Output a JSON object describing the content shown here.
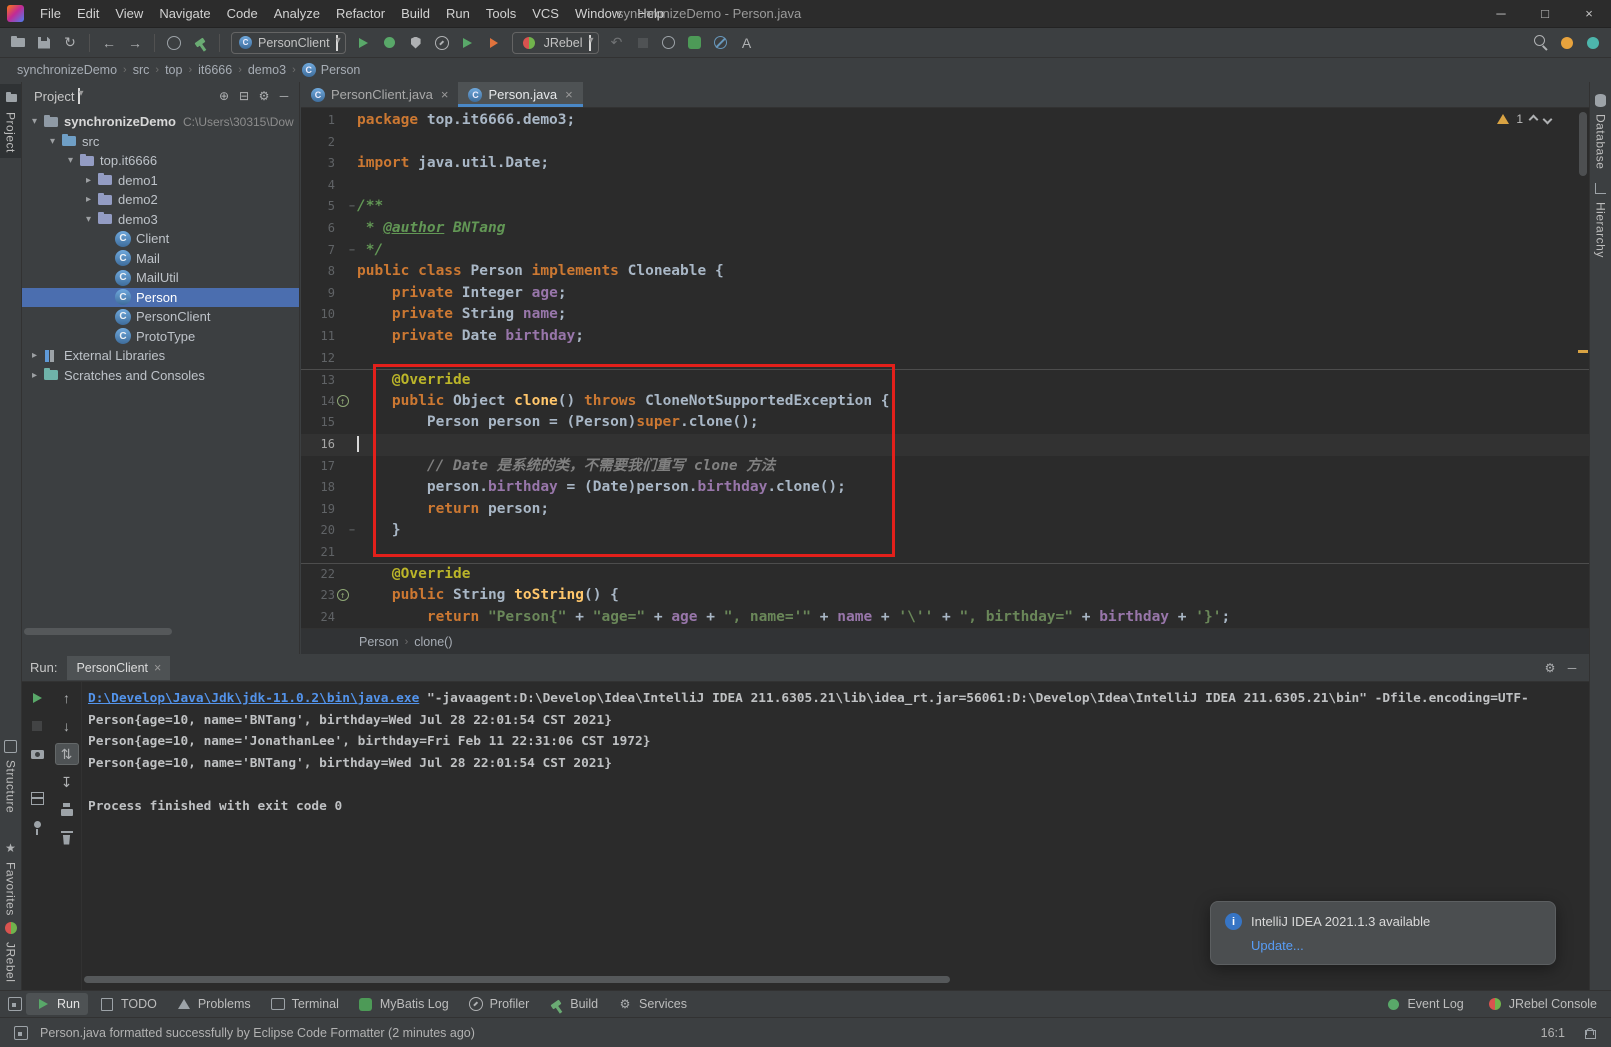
{
  "colors": {
    "accent_blue": "#4a88c7",
    "selection_blue": "#4b6eaf",
    "annotation_red": "#e3201b",
    "run_green": "#59a869",
    "warning_yellow": "#d9a343",
    "console_link": "#5394ec"
  },
  "title_bar": {
    "menus": [
      "File",
      "Edit",
      "View",
      "Navigate",
      "Code",
      "Analyze",
      "Refactor",
      "Build",
      "Run",
      "Tools",
      "VCS",
      "Window",
      "Help"
    ],
    "title": "synchronizeDemo - Person.java",
    "window_controls": [
      "minimize",
      "maximize",
      "close"
    ]
  },
  "toolbar": {
    "left_icons": [
      "open-icon",
      "save-icon",
      "sync-icon",
      "back-icon",
      "forward-icon",
      "run-anything-icon",
      "build-hammer-icon"
    ],
    "run_config": "PersonClient",
    "run_icons": [
      "run-icon",
      "debug-icon",
      "coverage-icon",
      "profiler-icon",
      "rerun-icon",
      "run-with-jrebel-icon"
    ],
    "jrebel_label": "JRebel",
    "mid_icons": [
      "revert-icon",
      "stop-icon",
      "code-with-me-icon",
      "mybatis-icon",
      "zen-mode-icon",
      "translate-icon"
    ],
    "right_icons": [
      "search-icon",
      "update-icon",
      "gradle-refresh-icon"
    ]
  },
  "breadcrumbs": [
    "synchronizeDemo",
    "src",
    "top",
    "it6666",
    "demo3",
    "Person"
  ],
  "project_panel": {
    "header": "Project",
    "header_icons": [
      "locate-icon",
      "collapse-all-icon",
      "settings-icon",
      "hide-icon"
    ],
    "tree": [
      {
        "label": "synchronizeDemo",
        "meta": "C:\\Users\\30315\\Dow",
        "depth": 0,
        "icon": "project-folder",
        "chevron": "down",
        "root": true
      },
      {
        "label": "src",
        "depth": 1,
        "icon": "src-folder",
        "chevron": "down"
      },
      {
        "label": "top.it6666",
        "depth": 2,
        "icon": "package",
        "chevron": "down"
      },
      {
        "label": "demo1",
        "depth": 3,
        "icon": "package",
        "chevron": "right"
      },
      {
        "label": "demo2",
        "depth": 3,
        "icon": "package",
        "chevron": "right"
      },
      {
        "label": "demo3",
        "depth": 3,
        "icon": "package",
        "chevron": "down"
      },
      {
        "label": "Client",
        "depth": 4,
        "icon": "class"
      },
      {
        "label": "Mail",
        "depth": 4,
        "icon": "class"
      },
      {
        "label": "MailUtil",
        "depth": 4,
        "icon": "class"
      },
      {
        "label": "Person",
        "depth": 4,
        "icon": "class",
        "selected": true
      },
      {
        "label": "PersonClient",
        "depth": 4,
        "icon": "class"
      },
      {
        "label": "ProtoType",
        "depth": 4,
        "icon": "class"
      },
      {
        "label": "External Libraries",
        "depth": 0,
        "icon": "libraries",
        "chevron": "right"
      },
      {
        "label": "Scratches and Consoles",
        "depth": 0,
        "icon": "scratches",
        "chevron": "right"
      }
    ]
  },
  "editor": {
    "tabs": [
      {
        "label": "PersonClient.java",
        "icon": "class",
        "active": false
      },
      {
        "label": "Person.java",
        "icon": "class",
        "active": true
      }
    ],
    "inspection_warnings": "1",
    "breadcrumb": [
      "Person",
      "clone()"
    ],
    "code": [
      {
        "n": 1,
        "t": [
          [
            "kw",
            "package"
          ],
          [
            "pl",
            " top.it6666.demo3;"
          ]
        ]
      },
      {
        "n": 2,
        "t": []
      },
      {
        "n": 3,
        "t": [
          [
            "kw",
            "import"
          ],
          [
            "pl",
            " java.util.Date;"
          ]
        ]
      },
      {
        "n": 4,
        "t": []
      },
      {
        "n": 5,
        "t": [
          [
            "doc",
            "/**"
          ]
        ],
        "g": "fold"
      },
      {
        "n": 6,
        "t": [
          [
            "doc",
            " * "
          ],
          [
            "doctag",
            "@author"
          ],
          [
            "docit",
            " BNTang"
          ]
        ]
      },
      {
        "n": 7,
        "t": [
          [
            "doc",
            " */"
          ]
        ],
        "g": "fold"
      },
      {
        "n": 8,
        "t": [
          [
            "kw",
            "public class "
          ],
          [
            "pl",
            "Person "
          ],
          [
            "kw",
            "implements "
          ],
          [
            "pl",
            "Cloneable {"
          ]
        ]
      },
      {
        "n": 9,
        "t": [
          [
            "pl",
            "    "
          ],
          [
            "kw",
            "private "
          ],
          [
            "pl",
            "Integer "
          ],
          [
            "fld",
            "age"
          ],
          [
            "pl",
            ";"
          ]
        ]
      },
      {
        "n": 10,
        "t": [
          [
            "pl",
            "    "
          ],
          [
            "kw",
            "private "
          ],
          [
            "pl",
            "String "
          ],
          [
            "fld",
            "name"
          ],
          [
            "pl",
            ";"
          ]
        ]
      },
      {
        "n": 11,
        "t": [
          [
            "pl",
            "    "
          ],
          [
            "kw",
            "private "
          ],
          [
            "pl",
            "Date "
          ],
          [
            "fld",
            "birthday"
          ],
          [
            "pl",
            ";"
          ]
        ]
      },
      {
        "n": 12,
        "t": []
      },
      {
        "n": 13,
        "t": [
          [
            "pl",
            "    "
          ],
          [
            "anno",
            "@Override"
          ]
        ],
        "sep": true
      },
      {
        "n": 14,
        "t": [
          [
            "pl",
            "    "
          ],
          [
            "kw",
            "public "
          ],
          [
            "pl",
            "Object "
          ],
          [
            "mth",
            "clone"
          ],
          [
            "pl",
            "() "
          ],
          [
            "kw",
            "throws "
          ],
          [
            "pl",
            "CloneNotSupportedException {"
          ]
        ],
        "g": "override"
      },
      {
        "n": 15,
        "t": [
          [
            "pl",
            "        Person person = (Person)"
          ],
          [
            "kw",
            "super"
          ],
          [
            "pl",
            ".clone();"
          ]
        ]
      },
      {
        "n": 16,
        "t": [],
        "cur": true
      },
      {
        "n": 17,
        "t": [
          [
            "pl",
            "        "
          ],
          [
            "cmt",
            "// Date 是系统的类，不需要我们重写 clone 方法"
          ]
        ]
      },
      {
        "n": 18,
        "t": [
          [
            "pl",
            "        person."
          ],
          [
            "fld",
            "birthday"
          ],
          [
            "pl",
            " = (Date)person."
          ],
          [
            "fld",
            "birthday"
          ],
          [
            "pl",
            ".clone();"
          ]
        ]
      },
      {
        "n": 19,
        "t": [
          [
            "pl",
            "        "
          ],
          [
            "kw",
            "return"
          ],
          [
            "pl",
            " person;"
          ]
        ]
      },
      {
        "n": 20,
        "t": [
          [
            "pl",
            "    }"
          ]
        ],
        "g": "fold"
      },
      {
        "n": 21,
        "t": []
      },
      {
        "n": 22,
        "t": [
          [
            "pl",
            "    "
          ],
          [
            "anno",
            "@Override"
          ]
        ],
        "sep": true
      },
      {
        "n": 23,
        "t": [
          [
            "pl",
            "    "
          ],
          [
            "kw",
            "public "
          ],
          [
            "pl",
            "String "
          ],
          [
            "mth",
            "toString"
          ],
          [
            "pl",
            "() {"
          ]
        ],
        "g": "override"
      },
      {
        "n": 24,
        "t": [
          [
            "pl",
            "        "
          ],
          [
            "kw",
            "return "
          ],
          [
            "str",
            "\"Person{\""
          ],
          [
            "pl",
            " + "
          ],
          [
            "str",
            "\"age=\""
          ],
          [
            "pl",
            " + "
          ],
          [
            "fld",
            "age"
          ],
          [
            "pl",
            " + "
          ],
          [
            "str",
            "\", name='\""
          ],
          [
            "pl",
            " + "
          ],
          [
            "fld",
            "name"
          ],
          [
            "pl",
            " + "
          ],
          [
            "str",
            "'\\''"
          ],
          [
            "pl",
            " + "
          ],
          [
            "str",
            "\", birthday=\""
          ],
          [
            "pl",
            " + "
          ],
          [
            "fld",
            "birthday"
          ],
          [
            "pl",
            " + "
          ],
          [
            "str",
            "'}'"
          ],
          [
            "pl",
            ";"
          ]
        ]
      }
    ]
  },
  "run_panel": {
    "label": "Run:",
    "tab": "PersonClient",
    "header_icons": [
      "settings-icon",
      "hide-icon"
    ],
    "toolbar_main": [
      "rerun-icon",
      "stop-icon",
      "profiler-snapshot-icon",
      "restore-layout-icon",
      "pin-icon"
    ],
    "toolbar_console": [
      "prev-occurrence-icon",
      "next-occurrence-icon",
      "soft-wrap-icon",
      "scroll-to-end-icon",
      "print-icon",
      "clear-all-icon"
    ],
    "console": [
      {
        "s": [
          [
            "link",
            "D:\\Develop\\Java\\Jdk\\jdk-11.0.2\\bin\\java.exe"
          ],
          [
            "pl",
            " \"-javaagent:D:\\Develop\\Idea\\IntelliJ IDEA 211.6305.21\\lib\\idea_rt.jar=56061:D:\\Develop\\Idea\\IntelliJ IDEA 211.6305.21\\bin\" -Dfile.encoding=UTF-"
          ]
        ]
      },
      {
        "s": [
          [
            "pl",
            "Person{age=10, name='BNTang', birthday=Wed Jul 28 22:01:54 CST 2021}"
          ]
        ]
      },
      {
        "s": [
          [
            "pl",
            "Person{age=10, name='JonathanLee', birthday=Fri Feb 11 22:31:06 CST 1972}"
          ]
        ]
      },
      {
        "s": [
          [
            "pl",
            "Person{age=10, name='BNTang', birthday=Wed Jul 28 22:01:54 CST 2021}"
          ]
        ]
      },
      {
        "s": []
      },
      {
        "s": [
          [
            "pl",
            "Process finished with exit code 0"
          ]
        ]
      }
    ]
  },
  "notification": {
    "icon": "info-icon",
    "title": "IntelliJ IDEA 2021.1.3 available",
    "action": "Update..."
  },
  "bottom_bar": {
    "switcher_icon": "tool-windows-icon",
    "left": [
      {
        "label": "Run",
        "icon": "run-icon",
        "active": true
      },
      {
        "label": "TODO",
        "icon": "todo-icon"
      },
      {
        "label": "Problems",
        "icon": "problems-icon"
      },
      {
        "label": "Terminal",
        "icon": "terminal-icon"
      },
      {
        "label": "MyBatis Log",
        "icon": "mybatis-icon"
      },
      {
        "label": "Profiler",
        "icon": "profiler-icon"
      },
      {
        "label": "Build",
        "icon": "build-hammer-icon"
      },
      {
        "label": "Services",
        "icon": "services-icon"
      }
    ],
    "right": [
      {
        "label": "Event Log",
        "icon": "event-log-icon"
      },
      {
        "label": "JRebel Console",
        "icon": "jrebel-icon"
      }
    ]
  },
  "status_bar": {
    "message": "Person.java formatted successfully by Eclipse Code Formatter (2 minutes ago)",
    "caret_position": "16:1"
  },
  "side_strips": {
    "left_top": [
      {
        "label": "Project",
        "icon": "project-icon",
        "active": true
      }
    ],
    "left_bottom": [
      {
        "label": "Structure",
        "icon": "structure-icon"
      },
      {
        "label": "Favorites",
        "icon": "favorites-icon"
      },
      {
        "label": "JRebel",
        "icon": "jrebel-icon"
      }
    ],
    "right": [
      {
        "label": "Database",
        "icon": "database-icon"
      },
      {
        "label": "Hierarchy",
        "icon": "hierarchy-icon"
      }
    ]
  }
}
